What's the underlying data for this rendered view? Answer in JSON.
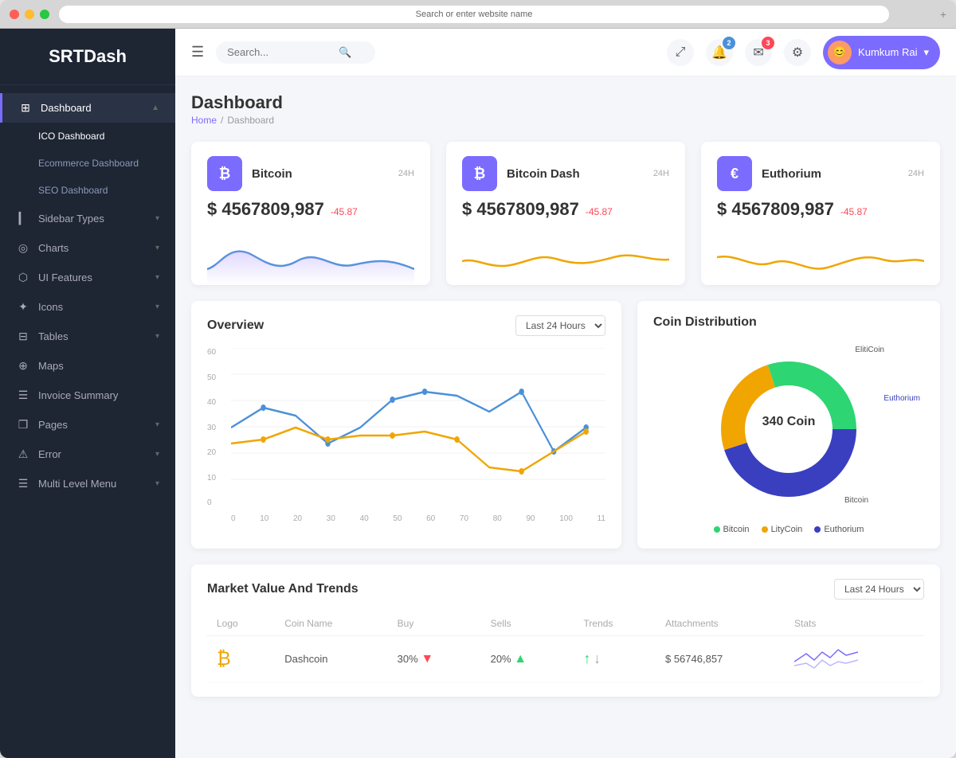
{
  "browser": {
    "address": "Search or enter website name"
  },
  "sidebar": {
    "logo": "SRTDash",
    "items": [
      {
        "id": "dashboard",
        "label": "Dashboard",
        "icon": "⊞",
        "active": true,
        "hasArrow": true
      },
      {
        "id": "ico-dashboard",
        "label": "ICO Dashboard",
        "sub": true,
        "activeSub": true
      },
      {
        "id": "ecommerce-dashboard",
        "label": "Ecommerce Dashboard",
        "sub": true
      },
      {
        "id": "seo-dashboard",
        "label": "SEO Dashboard",
        "sub": true
      },
      {
        "id": "sidebar-types",
        "label": "Sidebar Types",
        "icon": "▎",
        "hasArrow": true
      },
      {
        "id": "charts",
        "label": "Charts",
        "icon": "◎",
        "hasArrow": true
      },
      {
        "id": "ui-features",
        "label": "UI Features",
        "icon": "⬡",
        "hasArrow": true
      },
      {
        "id": "icons",
        "label": "Icons",
        "icon": "✦",
        "hasArrow": true
      },
      {
        "id": "tables",
        "label": "Tables",
        "icon": "⊟",
        "hasArrow": true
      },
      {
        "id": "maps",
        "label": "Maps",
        "icon": "⊕"
      },
      {
        "id": "invoice-summary",
        "label": "Invoice Summary",
        "icon": "☰"
      },
      {
        "id": "pages",
        "label": "Pages",
        "icon": "❐",
        "hasArrow": true
      },
      {
        "id": "error",
        "label": "Error",
        "icon": "⚠",
        "hasArrow": true
      },
      {
        "id": "multi-level-menu",
        "label": "Multi Level Menu",
        "icon": "☰",
        "hasArrow": true
      }
    ]
  },
  "topnav": {
    "search_placeholder": "Search...",
    "notifications_count": "2",
    "messages_count": "3",
    "user_name": "Kumkum Rai",
    "user_icon": "👤"
  },
  "page": {
    "title": "Dashboard",
    "breadcrumb_home": "Home",
    "breadcrumb_current": "Dashboard"
  },
  "crypto_cards": [
    {
      "icon": "₿",
      "icon_bg": "#7c6bff",
      "name": "Bitcoin",
      "period": "24H",
      "value": "$ 4567809,987",
      "change": "-45.87",
      "chart_color": "#4a90d9",
      "fill_color": "rgba(180,160,255,0.2)"
    },
    {
      "icon": "₿",
      "icon_bg": "#7c6bff",
      "name": "Bitcoin Dash",
      "period": "24H",
      "value": "$ 4567809,987",
      "change": "-45.87",
      "chart_color": "#f0a500",
      "fill_color": "rgba(240,165,0,0.1)"
    },
    {
      "icon": "€",
      "icon_bg": "#7c6bff",
      "name": "Euthorium",
      "period": "24H",
      "value": "$ 4567809,987",
      "change": "-45.87",
      "chart_color": "#f0a500",
      "fill_color": "rgba(240,165,0,0.1)"
    }
  ],
  "overview": {
    "title": "Overview",
    "period_select": "Last 24 Hours",
    "y_labels": [
      "60",
      "50",
      "40",
      "30",
      "20",
      "10",
      "0"
    ],
    "x_labels": [
      "0",
      "10",
      "20",
      "30",
      "40",
      "50",
      "60",
      "70",
      "80",
      "90",
      "100",
      "11"
    ]
  },
  "coin_distribution": {
    "title": "Coin Distribution",
    "center_label": "340 Coin",
    "segments": [
      {
        "label": "Bitcoin",
        "color": "#2ed573",
        "percent": 30
      },
      {
        "label": "LityCoin",
        "color": "#f0a500",
        "percent": 25
      },
      {
        "label": "Euthorium",
        "color": "#3a3fbf",
        "percent": 45
      }
    ],
    "donut_labels": {
      "top": "ElitiCoin",
      "right": "Euthorium",
      "bottom": "Bitcoin"
    }
  },
  "market_trends": {
    "title": "Market Value And Trends",
    "period_select": "Last 24 Hours",
    "columns": [
      "Logo",
      "Coin Name",
      "Buy",
      "Sells",
      "Trends",
      "Attachments",
      "Stats"
    ],
    "rows": [
      {
        "logo": "₿",
        "coin_name": "Dashcoin",
        "buy": "30%",
        "buy_trend": "down",
        "sells": "20%",
        "sells_trend": "up",
        "trend_up": true,
        "trend_down": true,
        "attachments": "$ 56746,857",
        "stats_color": "#7c6bff"
      }
    ]
  }
}
